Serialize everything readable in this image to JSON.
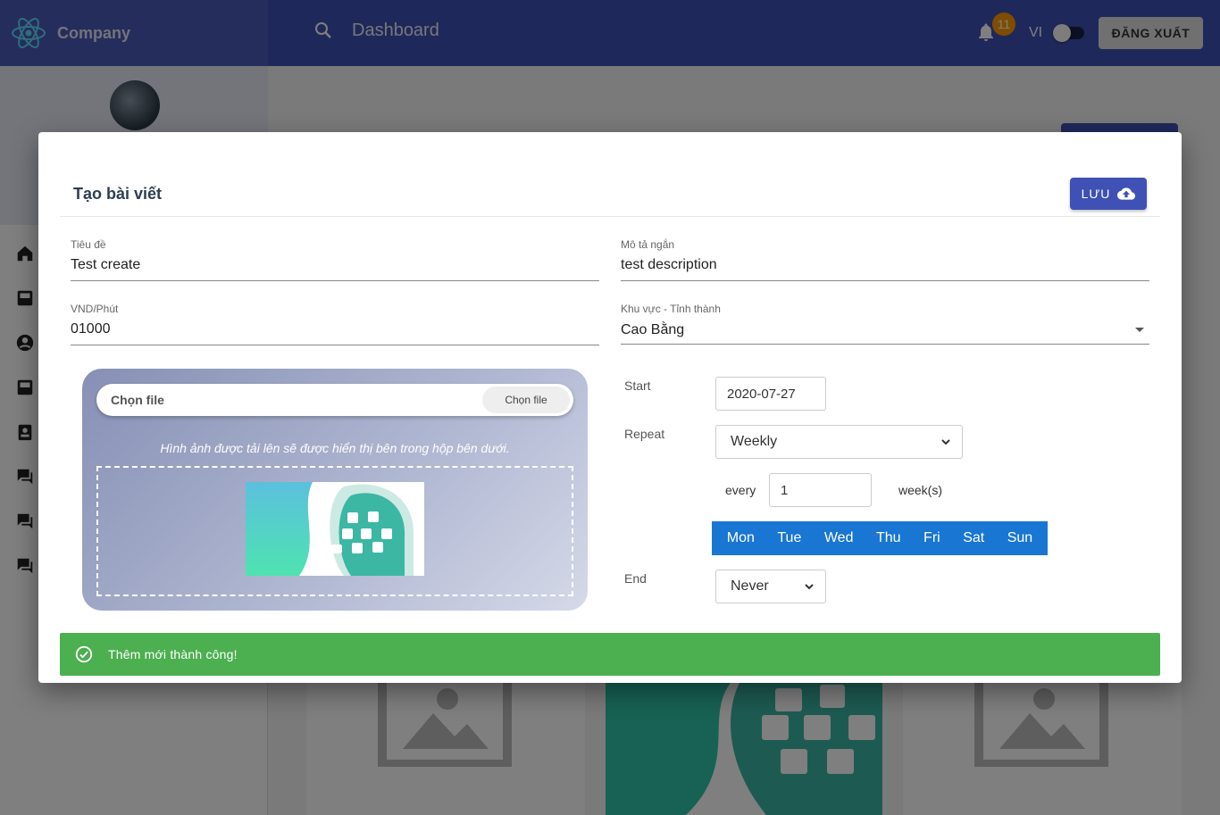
{
  "app": {
    "brand": "Company",
    "search_placeholder": "Dashboard",
    "notification_count": "11",
    "language": "VI",
    "logout_label": "ĐĂNG XUẤT"
  },
  "modal": {
    "title": "Tạo bài viết",
    "save_label": "LƯU",
    "fields": {
      "title": {
        "label": "Tiêu đề",
        "value": "Test create"
      },
      "short_desc": {
        "label": "Mô tả ngắn",
        "value": "test description"
      },
      "price": {
        "label": "VND/Phút",
        "value": "01000"
      },
      "region": {
        "label": "Khu vực - Tỉnh thành",
        "value": "Cao Bằng"
      }
    },
    "upload": {
      "choose_label": "Chọn file",
      "choose_button": "Chọn file",
      "note": "Hình ảnh được tải lên sẽ được hiển thị bên trong hộp bên dưới."
    },
    "schedule": {
      "start_label": "Start",
      "start_value": "2020-07-27",
      "repeat_label": "Repeat",
      "repeat_value": "Weekly",
      "every_label": "every",
      "every_value": "1",
      "every_unit": "week(s)",
      "days": [
        "Mon",
        "Tue",
        "Wed",
        "Thu",
        "Fri",
        "Sat",
        "Sun"
      ],
      "end_label": "End",
      "end_value": "Never"
    },
    "toast": "Thêm mới thành công!"
  },
  "colors": {
    "primary": "#3f51b5",
    "success": "#4caf50",
    "day_bar": "#1976d2",
    "badge": "#ff9800"
  }
}
